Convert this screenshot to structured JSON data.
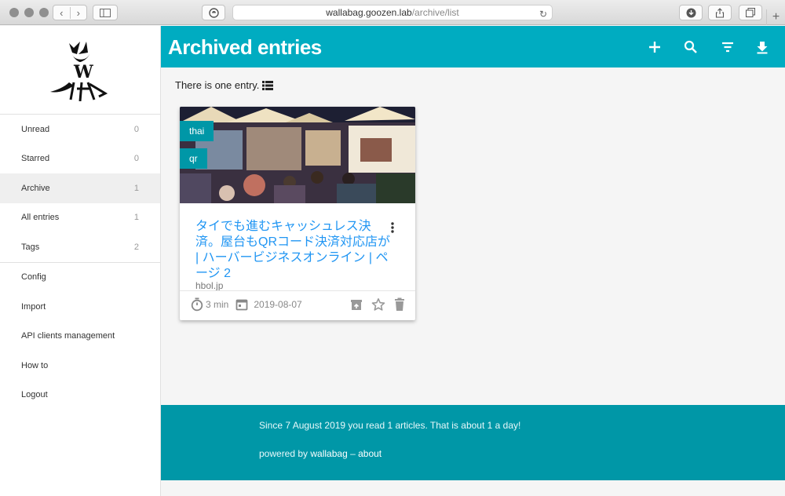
{
  "browser": {
    "url_host": "wallabag.goozen.lab",
    "url_path": "/archive/list"
  },
  "sidebar": {
    "items": [
      {
        "label": "Unread",
        "count": "0"
      },
      {
        "label": "Starred",
        "count": "0"
      },
      {
        "label": "Archive",
        "count": "1"
      },
      {
        "label": "All entries",
        "count": "1"
      },
      {
        "label": "Tags",
        "count": "2"
      }
    ],
    "secondary": [
      {
        "label": "Config"
      },
      {
        "label": "Import"
      },
      {
        "label": "API clients management"
      },
      {
        "label": "How to"
      },
      {
        "label": "Logout"
      }
    ]
  },
  "header": {
    "title": "Archived entries",
    "icons": [
      "add-icon",
      "search-icon",
      "filter-icon",
      "download-icon"
    ]
  },
  "main": {
    "entry_count_text": "There is one entry."
  },
  "card": {
    "tags": [
      "thai",
      "qr"
    ],
    "title": "タイでも進むキャッシュレス決済。屋台もQRコード決済対応店が | ハーバービジネスオンライン | ページ 2",
    "domain": "hbol.jp",
    "reading_time": "3 min",
    "date": "2019-08-07"
  },
  "footer": {
    "stats_text": "Since 7 August 2019 you read 1 articles. That is about 1 a day!",
    "powered_prefix": "powered by ",
    "powered_link": "wallabag",
    "separator": " – ",
    "about_link": "about"
  },
  "colors": {
    "header": "#00acc1",
    "footer": "#0097a7",
    "tag": "#0097a7",
    "link": "#2196f3"
  }
}
